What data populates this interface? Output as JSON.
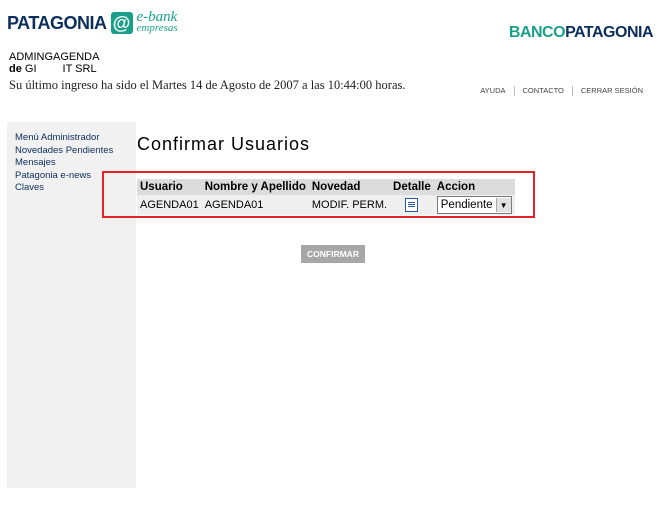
{
  "brand": {
    "patagonia": "PATAGONIA",
    "at_symbol": "@",
    "ebank_top": "e-bank",
    "ebank_bottom": "empresas",
    "bank_part1": "BANCO",
    "bank_part2": "PATAGONIA"
  },
  "user": {
    "name": "ADMINGAGENDA",
    "de_label": "de",
    "company_part1": "GI",
    "company_part2": "IT SRL",
    "last_login": "Su último ingreso ha sido el Martes 14 de Agosto de 2007 a las 10:44:00 horas."
  },
  "topnav": [
    "AYUDA",
    "CONTACTO",
    "CERRAR SESIÓN"
  ],
  "sidebar": [
    "Menú Administrador",
    "Novedades Pendientes",
    "Mensajes",
    "Patagonia e-news",
    "Claves"
  ],
  "page_title": "Confirmar Usuarios",
  "table": {
    "headers": [
      "Usuario",
      "Nombre y Apellido",
      "Novedad",
      "Detalle",
      "Accion"
    ],
    "rows": [
      {
        "usuario": "AGENDA01",
        "nombre": "AGENDA01",
        "novedad": "MODIF. PERM.",
        "accion": "Pendiente"
      }
    ]
  },
  "icons": {
    "detail": "document-icon",
    "dropdown": "chevron-down-icon"
  },
  "colors": {
    "accent": "#1aa08a",
    "brand_dark": "#0b2e5c",
    "highlight": "#e0242a",
    "button": "#a7a7a7"
  },
  "confirm_label": "CONFIRMAR"
}
